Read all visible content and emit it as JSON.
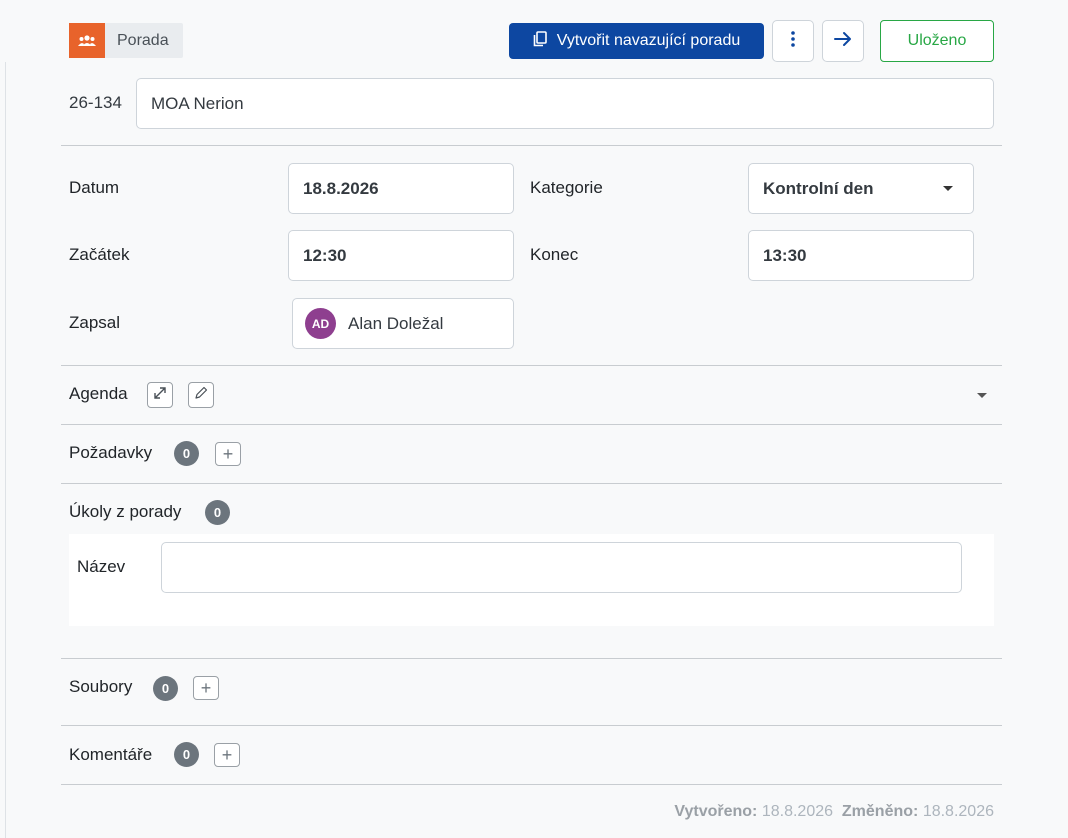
{
  "header": {
    "type_label": "Porada",
    "create_followup_label": "Vytvořit navazující poradu",
    "saved_label": "Uloženo"
  },
  "meeting": {
    "number": "26-134",
    "title": "MOA Nerion"
  },
  "fields": {
    "date_label": "Datum",
    "date_value": "18.8.2026",
    "category_label": "Kategorie",
    "category_value": "Kontrolní den",
    "start_label": "Začátek",
    "start_value": "12:30",
    "end_label": "Konec",
    "end_value": "13:30",
    "recorded_by_label": "Zapsal",
    "recorded_by_initials": "AD",
    "recorded_by_name": "Alan Doležal"
  },
  "sections": {
    "agenda_label": "Agenda",
    "requests_label": "Požadavky",
    "requests_count": "0",
    "tasks_label": "Úkoly z porady",
    "tasks_count": "0",
    "task_name_label": "Název",
    "task_name_value": "",
    "files_label": "Soubory",
    "files_count": "0",
    "comments_label": "Komentáře",
    "comments_count": "0"
  },
  "footer": {
    "created_label": "Vytvořeno:",
    "created_value": "18.8.2026",
    "modified_label": "Změněno:",
    "modified_value": "18.8.2026"
  },
  "colors": {
    "primary": "#0d47a1",
    "type_icon_bg": "#e8632b",
    "success": "#28a745",
    "avatar": "#8e3f8f",
    "badge": "#6c757d"
  }
}
